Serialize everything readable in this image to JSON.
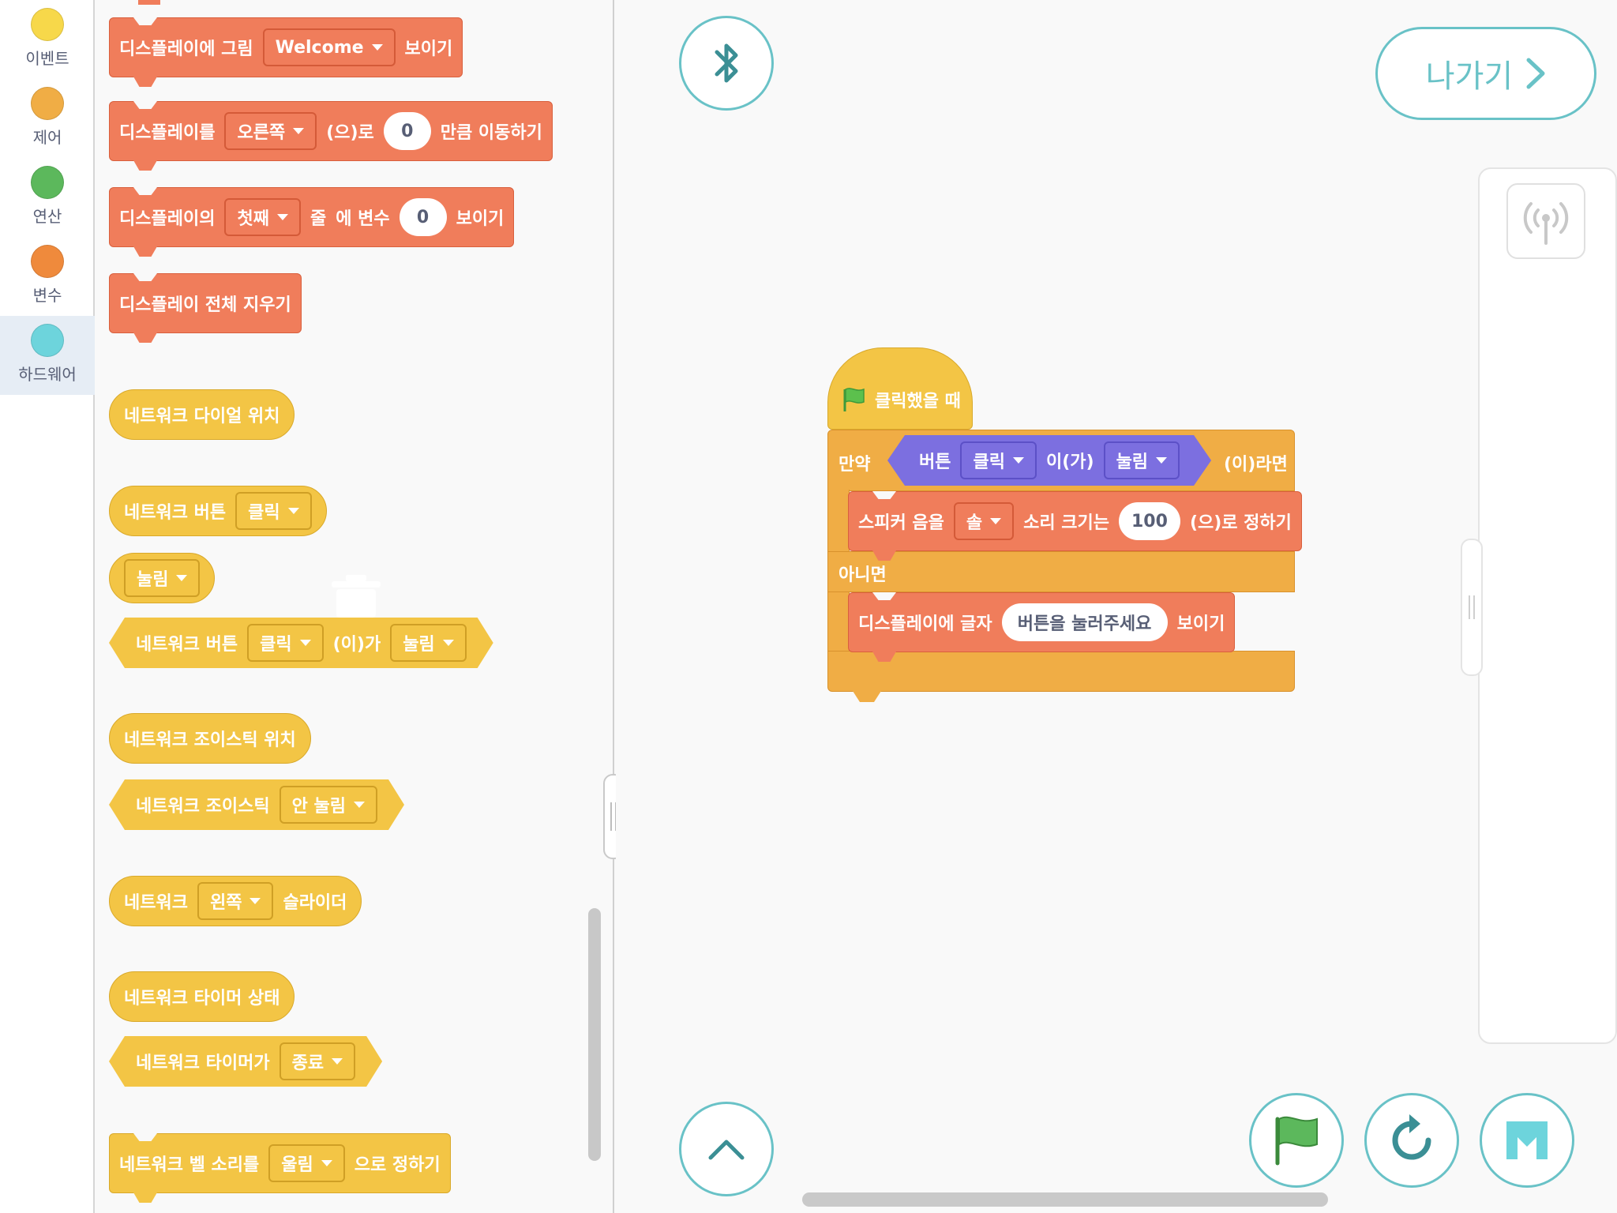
{
  "categories": [
    {
      "label": "이벤트",
      "color": "#f7d84a",
      "selected": false
    },
    {
      "label": "제어",
      "color": "#f0ad45",
      "selected": false
    },
    {
      "label": "연산",
      "color": "#5cb85c",
      "selected": false
    },
    {
      "label": "변수",
      "color": "#ef8a3c",
      "selected": false
    },
    {
      "label": "하드웨어",
      "color": "#6dd4dc",
      "selected": true
    }
  ],
  "palette": {
    "display_image": {
      "text1": "디스플레이에 그림",
      "dropdown": "Welcome",
      "text2": "보이기"
    },
    "display_move": {
      "text1": "디스플레이를",
      "dropdown": "오른쪽",
      "text2": "(으)로",
      "value": "0",
      "text3": "만큼 이동하기"
    },
    "display_var": {
      "text1": "디스플레이의",
      "dropdown": "첫째",
      "text2": "줄",
      "text3": "에 변수",
      "value": "0",
      "text4": "보이기"
    },
    "display_clear": {
      "text1": "디스플레이 전체 지우기"
    },
    "net_dial": {
      "text1": "네트워크 다이얼 위치"
    },
    "net_button": {
      "text1": "네트워크 버튼",
      "dropdown": "클릭"
    },
    "pressed_menu": {
      "dropdown": "눌림"
    },
    "net_button_bool": {
      "text1": "네트워크 버튼",
      "dropdown1": "클릭",
      "text2": "(이)가",
      "dropdown2": "눌림"
    },
    "net_joystick_pos": {
      "text1": "네트워크 조이스틱 위치"
    },
    "net_joystick_bool": {
      "text1": "네트워크 조이스틱",
      "dropdown": "안 눌림"
    },
    "net_slider": {
      "text1": "네트워크",
      "dropdown": "왼쪽",
      "text2": "슬라이더"
    },
    "net_timer_state": {
      "text1": "네트워크 타이머 상태"
    },
    "net_timer_bool": {
      "text1": "네트워크 타이머가",
      "dropdown": "종료"
    },
    "net_bell": {
      "text1": "네트워크 벨 소리를",
      "dropdown": "울림",
      "text2": "으로 정하기"
    }
  },
  "workspace": {
    "exit_label": "나가기",
    "script": {
      "hat_label": "클릭했을 때",
      "if_label": "만약",
      "cond_text1": "버튼",
      "cond_dropdown1": "클릭",
      "cond_text2": "이(가)",
      "cond_dropdown2": "눌림",
      "then_label": "(이)라면",
      "speaker_text1": "스피커 음을",
      "speaker_dropdown": "솔",
      "speaker_text2": "소리 크기는",
      "speaker_value": "100",
      "speaker_text3": "(으)로 정하기",
      "else_label": "아니면",
      "text_block_text1": "디스플레이에 글자",
      "text_block_value": "버튼을 눌러주세요",
      "text_block_text2": "보이기"
    }
  },
  "colors": {
    "accent": "#69c2c7",
    "looks": "#f07d5b",
    "network": "#f3c545",
    "control": "#f0ad45",
    "operator": "#7c6fe0"
  }
}
